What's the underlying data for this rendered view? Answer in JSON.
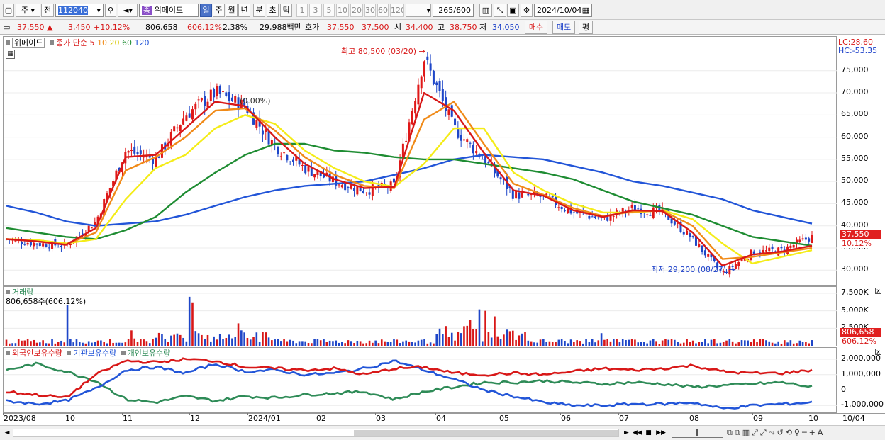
{
  "toolbar": {
    "market_type": "주",
    "prev_button": "전",
    "stock_code": "112040",
    "stock_badge": "종",
    "stock_name": "위메이드",
    "periods": [
      "일",
      "주",
      "월",
      "년",
      "분",
      "초",
      "틱"
    ],
    "selected_period": "일",
    "intervals": [
      "1",
      "3",
      "5",
      "10",
      "20",
      "30",
      "60",
      "120"
    ],
    "range_display": "265/600",
    "date": "2024/10/04"
  },
  "quote": {
    "price": "37,550",
    "change_arrow": "▲",
    "change": "3,450",
    "change_rate": "+10.12%",
    "volume": "806,658",
    "volume_ratio": "606.12%",
    "turnover": "2.38%",
    "trade_amount": "29,988백만",
    "quote_label": "호가",
    "ask": "37,550",
    "bid": "37,500",
    "open_label": "시",
    "open": "34,400",
    "high_label": "고",
    "high": "38,750",
    "low_label": "저",
    "low": "34,050",
    "buy_button": "매수",
    "sell_button": "매도",
    "avg_button": "평"
  },
  "price_pane": {
    "title": "위메이드",
    "legend_close": "종가",
    "legend_simple": "단순",
    "ma_labels": [
      "5",
      "10",
      "20",
      "60",
      "120"
    ],
    "ma_colors": [
      "#d81818",
      "#f08a18",
      "#f4ec18",
      "#1e8c32",
      "#2255d8"
    ],
    "lc_label": "LC:28.60",
    "hc_label": "HC:-53.35",
    "high_annotation": "최고 80,500 (03/20)",
    "low_annotation": "최저 29,200 (08/27)",
    "mid_annotation": "(0.00%)",
    "y_ticks": [
      "75,000",
      "70,000",
      "65,000",
      "60,000",
      "55,000",
      "50,000",
      "45,000",
      "40,000",
      "35,000",
      "30,000"
    ],
    "price_tag": "37,550",
    "pct_tag": "10.12%"
  },
  "volume_pane": {
    "title": "거래량",
    "value_text": "806,658주(606.12%)",
    "y_ticks": [
      "7,500K",
      "5,000K",
      "2,500K"
    ],
    "volume_tag": "806,658",
    "pct_tag": "606.12%"
  },
  "holding_pane": {
    "legend": [
      "외국인보유수량",
      "기관보유수량",
      "개인보유수량"
    ],
    "colors": [
      "#d81818",
      "#2255d8",
      "#2e8b57"
    ],
    "y_ticks": [
      "2,000,000",
      "1,000,000",
      "0",
      "-1,000,000"
    ]
  },
  "x_axis": {
    "labels": [
      "2023/08",
      "10",
      "11",
      "12",
      "2024/01",
      "02",
      "03",
      "04",
      "05",
      "06",
      "07",
      "08",
      "09",
      "10"
    ],
    "end_label": "10/04"
  },
  "chart_data": {
    "type": "candlestick",
    "title": "위메이드",
    "x_start": "2023/08",
    "x_end": "2024/10/04",
    "ylim": [
      27000,
      82000
    ],
    "close_points": [
      [
        "2023/08",
        37000
      ],
      [
        "2023/09",
        36000
      ],
      [
        "2023/10",
        35500
      ],
      [
        "2023/11",
        41000
      ],
      [
        "2023/11",
        57000
      ],
      [
        "2023/11",
        55000
      ],
      [
        "2023/12",
        65000
      ],
      [
        "2023/12",
        70000
      ],
      [
        "2023/12",
        67000
      ],
      [
        "2024/01",
        58000
      ],
      [
        "2024/01",
        53000
      ],
      [
        "2024/02",
        50000
      ],
      [
        "2024/02",
        48000
      ],
      [
        "2024/03",
        49000
      ],
      [
        "2024/03",
        78000
      ],
      [
        "2024/04",
        62000
      ],
      [
        "2024/04",
        55000
      ],
      [
        "2024/05",
        47000
      ],
      [
        "2024/05",
        46500
      ],
      [
        "2024/06",
        43000
      ],
      [
        "2024/06",
        41500
      ],
      [
        "2024/07",
        44000
      ],
      [
        "2024/07",
        43000
      ],
      [
        "2024/08",
        37000
      ],
      [
        "2024/08",
        29200
      ],
      [
        "2024/09",
        34000
      ],
      [
        "2024/09",
        34500
      ],
      [
        "2024/10",
        37550
      ]
    ],
    "ma_series": [
      {
        "name": "5",
        "values": [
          37000,
          36500,
          35700,
          39500,
          55500,
          56000,
          62000,
          68000,
          67000,
          60000,
          54000,
          50500,
          48500,
          48800,
          70000,
          66000,
          56500,
          48000,
          46800,
          43500,
          42000,
          43500,
          43300,
          38500,
          31000,
          33500,
          34200,
          35500
        ]
      },
      {
        "name": "10",
        "values": [
          37000,
          36500,
          35800,
          38500,
          52500,
          55500,
          60000,
          66000,
          66500,
          61500,
          55500,
          51500,
          49000,
          48500,
          64000,
          68000,
          58500,
          49500,
          47000,
          44000,
          42200,
          43200,
          43400,
          40000,
          32500,
          33000,
          34000,
          35000
        ]
      },
      {
        "name": "20",
        "values": [
          37000,
          36800,
          36000,
          37000,
          46000,
          53000,
          56000,
          62000,
          65000,
          63000,
          57000,
          53000,
          50000,
          48800,
          54000,
          62000,
          62000,
          52000,
          48000,
          45000,
          43000,
          43000,
          43500,
          41500,
          36000,
          31500,
          33000,
          34500
        ]
      },
      {
        "name": "60",
        "values": [
          39500,
          38500,
          37500,
          37000,
          39000,
          42000,
          47500,
          52000,
          56000,
          58500,
          58500,
          57000,
          56500,
          55500,
          55000,
          55000,
          54000,
          53000,
          52000,
          50500,
          48000,
          45500,
          44000,
          42500,
          40000,
          37500,
          36500,
          35500
        ]
      },
      {
        "name": "120",
        "values": [
          44500,
          43000,
          41000,
          40000,
          40500,
          41000,
          42500,
          44500,
          46500,
          48000,
          49000,
          49500,
          50000,
          51500,
          53000,
          55000,
          56000,
          55500,
          55000,
          53500,
          52000,
          50000,
          49000,
          47500,
          46000,
          43500,
          42000,
          40500
        ]
      }
    ],
    "annotations": {
      "max": "최고 80,500 (03/20)",
      "min": "최저 29,200 (08/27)"
    },
    "volume_ylim": [
      0,
      8000000
    ],
    "holdings": {
      "series": [
        {
          "name": "외국인보유수량",
          "values": [
            -100000,
            -300000,
            -500000,
            1000000,
            1900000,
            1800000,
            2000000,
            1900000,
            1500000,
            1400000,
            1300000,
            1400000,
            1000000,
            1400000,
            1500000,
            1100000,
            1000000,
            1100000,
            1000000,
            1200000,
            1400000,
            1300000,
            1400000,
            1600000,
            1200000,
            1100000,
            1100000,
            1300000
          ]
        },
        {
          "name": "기관보유수량",
          "values": [
            -700000,
            -900000,
            -700000,
            100000,
            1300000,
            1500000,
            1100000,
            1700000,
            1200000,
            1300000,
            1000000,
            1100000,
            1400000,
            1900000,
            1300000,
            700000,
            0,
            -400000,
            -800000,
            -1000000,
            -1000000,
            -900000,
            -900000,
            -800000,
            -1200000,
            -1000000,
            -900000,
            -800000
          ]
        },
        {
          "name": "개인보유수량",
          "values": [
            1300000,
            1700000,
            1200000,
            600000,
            -600000,
            -800000,
            -400000,
            -700000,
            -400000,
            -500000,
            -300000,
            -200000,
            -100000,
            -600000,
            -100000,
            200000,
            500000,
            500000,
            600000,
            500000,
            400000,
            500000,
            400000,
            200000,
            300000,
            400000,
            500000,
            200000
          ]
        }
      ],
      "ylim": [
        -1400000,
        2600000
      ]
    }
  }
}
